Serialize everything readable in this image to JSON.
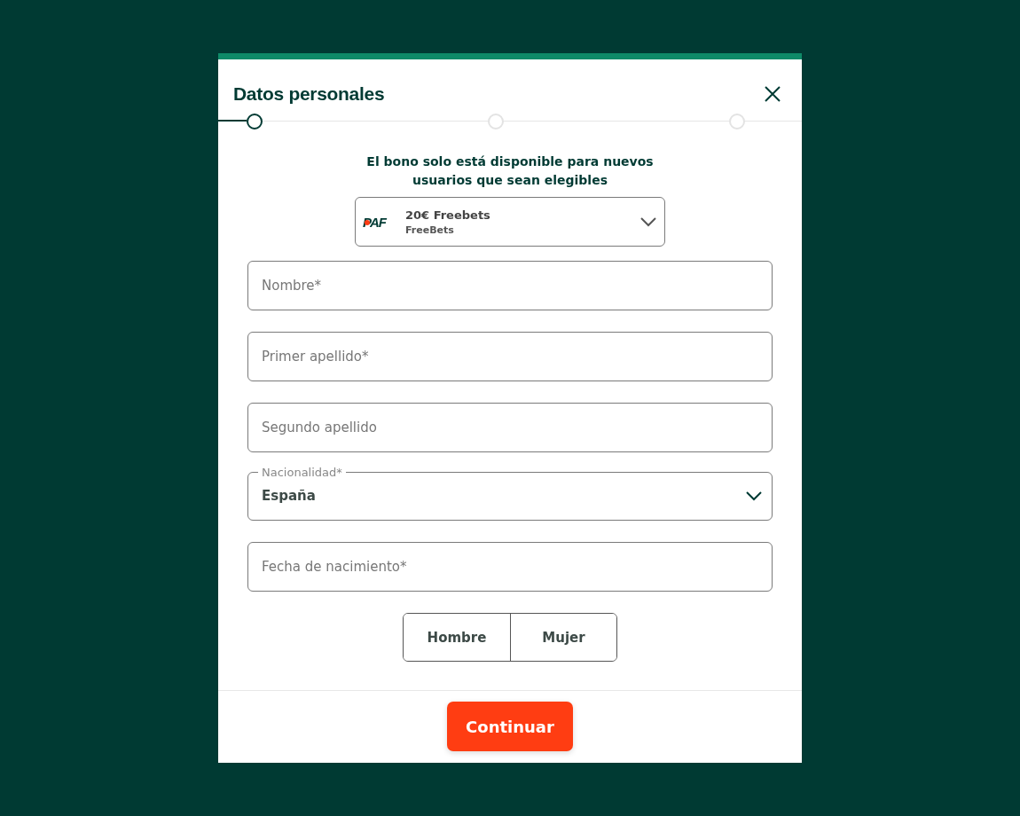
{
  "modal": {
    "title": "Datos personales"
  },
  "steps": [
    {
      "selected": true
    },
    {
      "selected": false
    },
    {
      "selected": false
    }
  ],
  "bonus": {
    "notice": "El bono solo está disponible para nuevos usuarios que sean elegibles",
    "logo": "PAF",
    "name": "20€ Freebets",
    "type": "FreeBets"
  },
  "fields": [
    {
      "kind": "text",
      "placeholder": "Nombre*"
    },
    {
      "kind": "text",
      "placeholder": "Primer apellido*"
    },
    {
      "kind": "text",
      "placeholder": "Segundo apellido"
    },
    {
      "kind": "select",
      "label": "Nacionalidad*",
      "value": "España"
    },
    {
      "kind": "text",
      "placeholder": "Fecha de nacimiento*"
    }
  ],
  "gender": [
    {
      "label": "Hombre",
      "selected": false
    },
    {
      "label": "Mujer",
      "selected": false
    }
  ],
  "footer": {
    "button": "Continuar"
  }
}
